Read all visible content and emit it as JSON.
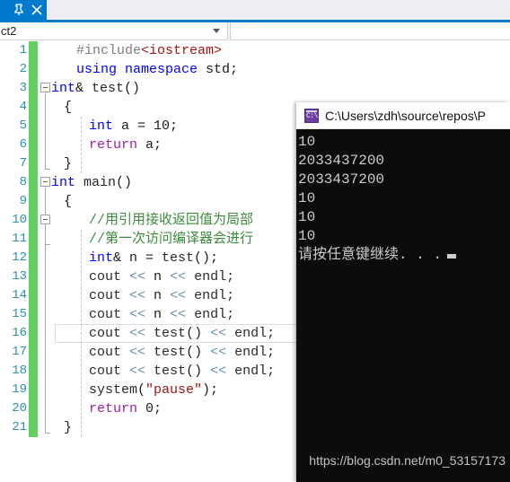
{
  "window": {
    "tab": {
      "pin_icon": "pin-icon",
      "close_icon": "close-icon",
      "active_tab_color": "#007acc"
    },
    "navbar": {
      "combo_value": "ct2",
      "combo_arrow_icon": "chevron-down-icon"
    }
  },
  "editor": {
    "change_bar_color": "#62d162",
    "line_number_color": "#2b91af",
    "current_line": 25,
    "lines": [
      {
        "num": 1,
        "indent": 2,
        "tokens": [
          {
            "t": "#include",
            "c": "t-pp"
          },
          {
            "t": "<iostream>",
            "c": "t-str"
          }
        ]
      },
      {
        "num": 2,
        "indent": 2,
        "tokens": [
          {
            "t": "using namespace",
            "c": "t-kw"
          },
          {
            "t": " std;",
            "c": "t-plain"
          }
        ]
      },
      {
        "num": 3,
        "indent": 0,
        "tokens": [
          {
            "t": "int",
            "c": "t-kw"
          },
          {
            "t": "& ",
            "c": "t-plain"
          },
          {
            "t": "test",
            "c": "t-id"
          },
          {
            "t": "()",
            "c": "t-plain"
          }
        ]
      },
      {
        "num": 4,
        "indent": 1,
        "tokens": [
          {
            "t": "{",
            "c": "t-plain"
          }
        ]
      },
      {
        "num": 5,
        "indent": 3,
        "tokens": [
          {
            "t": "int",
            "c": "t-kw"
          },
          {
            "t": " a = ",
            "c": "t-plain"
          },
          {
            "t": "10",
            "c": "t-plain"
          },
          {
            "t": ";",
            "c": "t-plain"
          }
        ]
      },
      {
        "num": 6,
        "indent": 3,
        "tokens": [
          {
            "t": "return",
            "c": "t-ctl"
          },
          {
            "t": " a;",
            "c": "t-plain"
          }
        ]
      },
      {
        "num": 7,
        "indent": 1,
        "tokens": [
          {
            "t": "}",
            "c": "t-plain"
          }
        ]
      },
      {
        "num": 8,
        "indent": 0,
        "tokens": [
          {
            "t": "int",
            "c": "t-kw"
          },
          {
            "t": " ",
            "c": "t-plain"
          },
          {
            "t": "main",
            "c": "t-id"
          },
          {
            "t": "()",
            "c": "t-plain"
          }
        ]
      },
      {
        "num": 9,
        "indent": 1,
        "tokens": [
          {
            "t": "{",
            "c": "t-plain"
          }
        ]
      },
      {
        "num": 10,
        "indent": 3,
        "tokens": [
          {
            "t": "//用引用接收返回值为局部",
            "c": "t-cmt"
          }
        ]
      },
      {
        "num": 11,
        "indent": 3,
        "tokens": [
          {
            "t": "//第一次访问编译器会进行",
            "c": "t-cmt"
          }
        ]
      },
      {
        "num": 12,
        "indent": 3,
        "tokens": [
          {
            "t": "int",
            "c": "t-kw"
          },
          {
            "t": "& n = ",
            "c": "t-plain"
          },
          {
            "t": "test",
            "c": "t-id"
          },
          {
            "t": "();",
            "c": "t-plain"
          }
        ]
      },
      {
        "num": 13,
        "indent": 3,
        "tokens": [
          {
            "t": "cout ",
            "c": "t-id"
          },
          {
            "t": "<<",
            "c": "t-op"
          },
          {
            "t": " n ",
            "c": "t-plain"
          },
          {
            "t": "<<",
            "c": "t-op"
          },
          {
            "t": " endl;",
            "c": "t-id"
          }
        ]
      },
      {
        "num": 14,
        "indent": 3,
        "tokens": [
          {
            "t": "cout ",
            "c": "t-id"
          },
          {
            "t": "<<",
            "c": "t-op"
          },
          {
            "t": " n ",
            "c": "t-plain"
          },
          {
            "t": "<<",
            "c": "t-op"
          },
          {
            "t": " endl;",
            "c": "t-id"
          }
        ]
      },
      {
        "num": 15,
        "indent": 3,
        "tokens": [
          {
            "t": "cout ",
            "c": "t-id"
          },
          {
            "t": "<<",
            "c": "t-op"
          },
          {
            "t": " n ",
            "c": "t-plain"
          },
          {
            "t": "<<",
            "c": "t-op"
          },
          {
            "t": " endl;",
            "c": "t-id"
          }
        ]
      },
      {
        "num": 16,
        "indent": 3,
        "tokens": [
          {
            "t": "cout ",
            "c": "t-id"
          },
          {
            "t": "<<",
            "c": "t-op"
          },
          {
            "t": " ",
            "c": "t-plain"
          },
          {
            "t": "test",
            "c": "t-id"
          },
          {
            "t": "() ",
            "c": "t-plain"
          },
          {
            "t": "<<",
            "c": "t-op"
          },
          {
            "t": " endl;",
            "c": "t-id"
          }
        ]
      },
      {
        "num": 17,
        "indent": 3,
        "tokens": [
          {
            "t": "cout ",
            "c": "t-id"
          },
          {
            "t": "<<",
            "c": "t-op"
          },
          {
            "t": " ",
            "c": "t-plain"
          },
          {
            "t": "test",
            "c": "t-id"
          },
          {
            "t": "() ",
            "c": "t-plain"
          },
          {
            "t": "<<",
            "c": "t-op"
          },
          {
            "t": " endl;",
            "c": "t-id"
          }
        ]
      },
      {
        "num": 18,
        "indent": 3,
        "tokens": [
          {
            "t": "cout ",
            "c": "t-id"
          },
          {
            "t": "<<",
            "c": "t-op"
          },
          {
            "t": " ",
            "c": "t-plain"
          },
          {
            "t": "test",
            "c": "t-id"
          },
          {
            "t": "() ",
            "c": "t-plain"
          },
          {
            "t": "<<",
            "c": "t-op"
          },
          {
            "t": " endl;",
            "c": "t-id"
          }
        ]
      },
      {
        "num": 19,
        "indent": 3,
        "tokens": [
          {
            "t": "system",
            "c": "t-id"
          },
          {
            "t": "(",
            "c": "t-plain"
          },
          {
            "t": "\"pause\"",
            "c": "t-str"
          },
          {
            "t": ");",
            "c": "t-plain"
          }
        ]
      },
      {
        "num": 20,
        "indent": 3,
        "tokens": [
          {
            "t": "return",
            "c": "t-ctl"
          },
          {
            "t": " ",
            "c": "t-plain"
          },
          {
            "t": "0",
            "c": "t-plain"
          },
          {
            "t": ";",
            "c": "t-plain"
          }
        ]
      },
      {
        "num": 21,
        "indent": 1,
        "tokens": [
          {
            "t": "}",
            "c": "t-plain"
          }
        ]
      }
    ]
  },
  "console": {
    "title": "C:\\Users\\zdh\\source\\repos\\P",
    "icon": "console-app-icon",
    "icon_glyph": "C:\\",
    "output": [
      "10",
      "2033437200",
      "2033437200",
      "10",
      "10",
      "10"
    ],
    "prompt": "请按任意键继续. . .",
    "cursor": "block-cursor"
  },
  "watermark": {
    "text": "https://blog.csdn.net/m0_53157173"
  }
}
